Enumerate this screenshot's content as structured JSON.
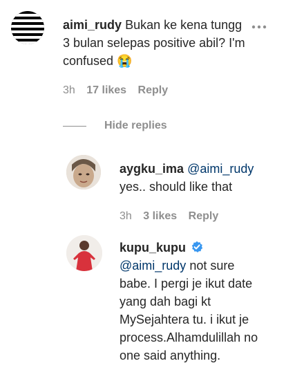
{
  "comments": [
    {
      "username": "aimi_rudy",
      "text_line1": "Bukan ke kena tungg",
      "text_line2": "3 bulan selepas positive abil? I'm",
      "text_line3": "confused",
      "emoji": "😭",
      "time": "3h",
      "likes": "17 likes",
      "reply_label": "Reply",
      "more_icon": "ellipsis-icon"
    }
  ],
  "replies_toggle": {
    "label": "Hide replies"
  },
  "replies": [
    {
      "username": "aygku_ima",
      "mention": "@aimi_rudy",
      "text": "yes.. should like that",
      "time": "3h",
      "likes": "3 likes",
      "reply_label": "Reply"
    },
    {
      "username": "kupu_kupu",
      "verified": true,
      "mention": "@aimi_rudy",
      "text_line1": "not sure",
      "text_line2": "babe. I pergi je ikut date",
      "text_line3": "yang dah bagi kt",
      "text_line4": "MySejahtera tu. i ikut je",
      "text_line5": "process.Alhamdulillah no",
      "text_line6": "one said anything.",
      "verified_color": "#3897f0"
    }
  ]
}
